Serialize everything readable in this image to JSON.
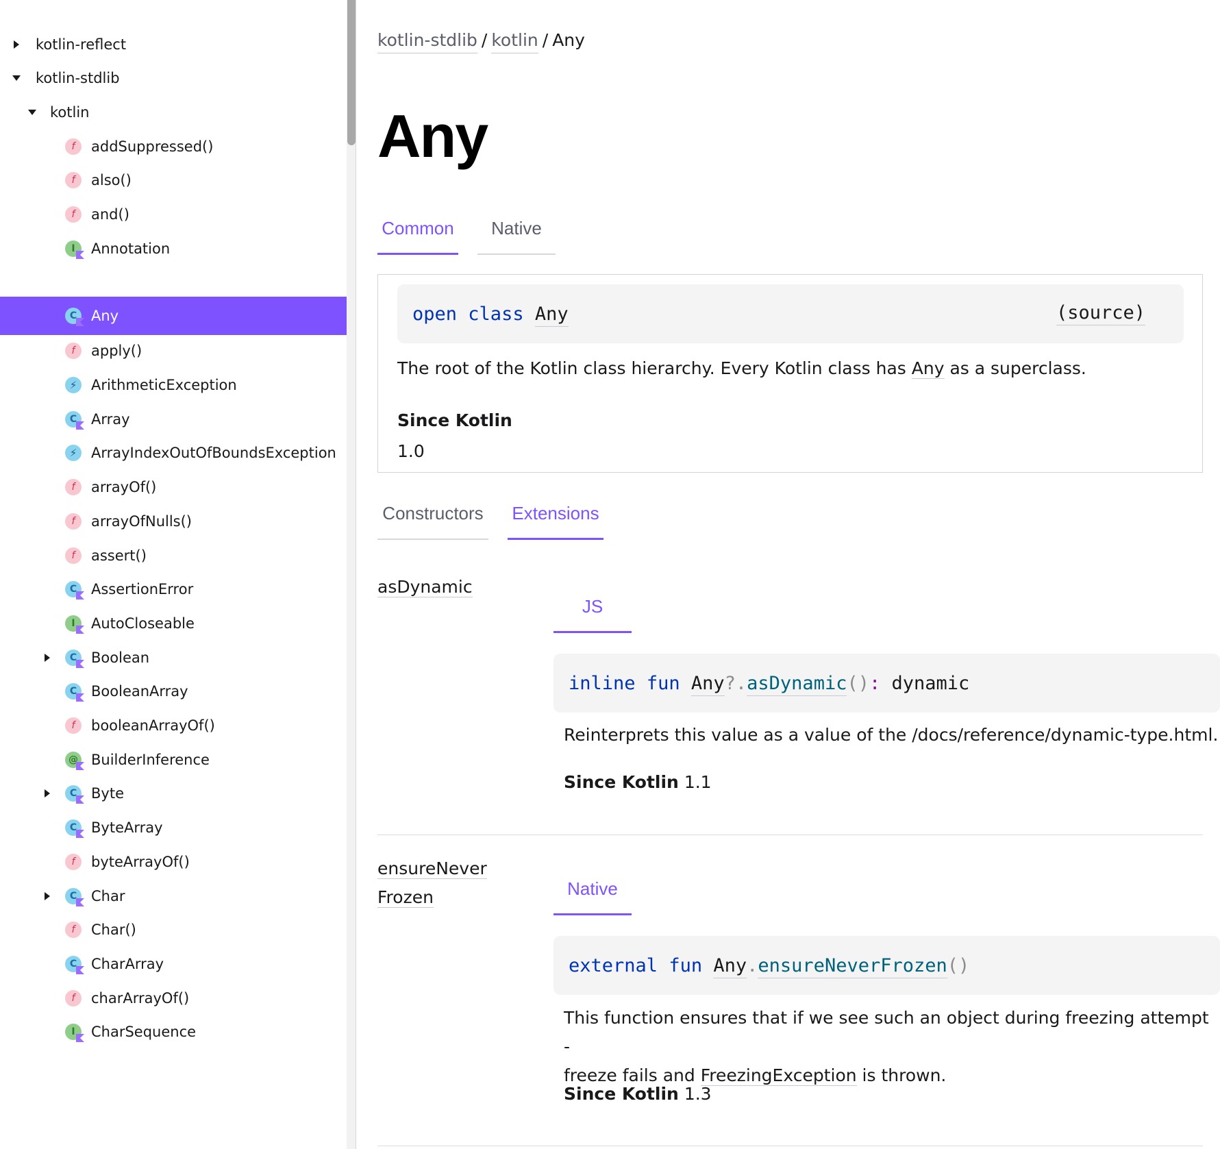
{
  "sidebar": {
    "items": [
      {
        "label": "kotlin-reflect",
        "toggle": "collapsed",
        "icon": ""
      },
      {
        "label": "kotlin-stdlib",
        "toggle": "expanded",
        "icon": ""
      },
      {
        "label": "kotlin",
        "toggle": "expanded",
        "icon": ""
      },
      {
        "label": "addSuppressed()",
        "toggle": "",
        "icon": "function-icon"
      },
      {
        "label": "also()",
        "toggle": "",
        "icon": "function-icon"
      },
      {
        "label": "and()",
        "toggle": "",
        "icon": "function-icon"
      },
      {
        "label": "Annotation",
        "toggle": "",
        "icon": "interface-icon"
      },
      {
        "label": "Any",
        "toggle": "",
        "icon": "class-icon",
        "selected": true
      },
      {
        "label": "apply()",
        "toggle": "",
        "icon": "function-icon"
      },
      {
        "label": "ArithmeticException",
        "toggle": "",
        "icon": "exception-icon"
      },
      {
        "label": "Array",
        "toggle": "",
        "icon": "class-icon"
      },
      {
        "label": "ArrayIndexOutOfBoundsException",
        "toggle": "",
        "icon": "exception-icon"
      },
      {
        "label": "arrayOf()",
        "toggle": "",
        "icon": "function-icon"
      },
      {
        "label": "arrayOfNulls()",
        "toggle": "",
        "icon": "function-icon"
      },
      {
        "label": "assert()",
        "toggle": "",
        "icon": "function-icon"
      },
      {
        "label": "AssertionError",
        "toggle": "",
        "icon": "class-icon"
      },
      {
        "label": "AutoCloseable",
        "toggle": "",
        "icon": "interface-icon"
      },
      {
        "label": "Boolean",
        "toggle": "collapsed",
        "icon": "class-icon"
      },
      {
        "label": "BooleanArray",
        "toggle": "",
        "icon": "class-icon"
      },
      {
        "label": "booleanArrayOf()",
        "toggle": "",
        "icon": "function-icon"
      },
      {
        "label": "BuilderInference",
        "toggle": "",
        "icon": "annotation-icon"
      },
      {
        "label": "Byte",
        "toggle": "collapsed",
        "icon": "class-icon"
      },
      {
        "label": "ByteArray",
        "toggle": "",
        "icon": "class-icon"
      },
      {
        "label": "byteArrayOf()",
        "toggle": "",
        "icon": "function-icon"
      },
      {
        "label": "Char",
        "toggle": "collapsed",
        "icon": "class-icon"
      },
      {
        "label": "Char()",
        "toggle": "",
        "icon": "function-icon"
      },
      {
        "label": "CharArray",
        "toggle": "",
        "icon": "class-icon"
      },
      {
        "label": "charArrayOf()",
        "toggle": "",
        "icon": "function-icon"
      },
      {
        "label": "CharSequence",
        "toggle": "",
        "icon": "interface-icon"
      }
    ]
  },
  "breadcrumb": {
    "items": [
      "kotlin-stdlib",
      "kotlin"
    ],
    "separator": "/",
    "current": "Any"
  },
  "page_title": "Any",
  "platform_tabs": {
    "common": "Common",
    "native": "Native"
  },
  "declaration": {
    "kw1": "open",
    "kw2": "class",
    "name": "Any",
    "source": "(source)"
  },
  "description": {
    "before": "The root of the Kotlin class hierarchy. Every Kotlin class has ",
    "link": "Any",
    "after": " as a superclass."
  },
  "since": {
    "heading": "Since Kotlin",
    "version": "1.0"
  },
  "section_tabs": {
    "constructors": "Constructors",
    "extensions": "Extensions"
  },
  "extensions": [
    {
      "name_lines": [
        "asDynamic"
      ],
      "platform": "JS",
      "sig": {
        "kw1": "inline",
        "kw2": "fun",
        "receiver": "Any",
        "op": "?.",
        "fn": "asDynamic",
        "parens": "()",
        "colon": ":",
        "ret": "dynamic"
      },
      "desc_line1": "Reinterprets this value as a value of the /docs/reference/dynamic-type.html.",
      "since_label": "Since Kotlin",
      "since_version": "1.1"
    },
    {
      "name_lines": [
        "ensureNever",
        "Frozen"
      ],
      "platform": "Native",
      "sig": {
        "kw1": "external",
        "kw2": "fun",
        "receiver": "Any",
        "op": ".",
        "fn": "ensureNeverFrozen",
        "parens": "()"
      },
      "desc_line1": "This function ensures that if we see such an object during freezing attempt -",
      "desc_line2_before": "freeze fails and ",
      "desc_line2_link": "FreezingException",
      "desc_line2_after": " is thrown.",
      "since_label": "Since Kotlin",
      "since_version": "1.3"
    }
  ],
  "colors": {
    "accent": "#7f52ff",
    "keyword": "#0033b3",
    "function": "#00627a"
  }
}
